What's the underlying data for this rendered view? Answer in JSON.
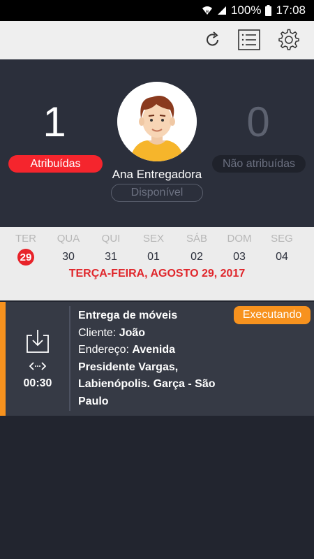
{
  "statusbar": {
    "battery": "100%",
    "time": "17:08"
  },
  "toolbar": {
    "refresh_icon": "refresh-icon",
    "list_icon": "list-icon",
    "settings_icon": "gear-icon"
  },
  "summary": {
    "assigned_count": "1",
    "assigned_label": "Atribuídas",
    "unassigned_count": "0",
    "unassigned_label": "Não atribuídas",
    "user_name": "Ana Entregadora",
    "user_status": "Disponível"
  },
  "calendar": {
    "days": [
      {
        "dow": "TER",
        "num": "29",
        "selected": true
      },
      {
        "dow": "QUA",
        "num": "30"
      },
      {
        "dow": "QUI",
        "num": "31"
      },
      {
        "dow": "SEX",
        "num": "01"
      },
      {
        "dow": "SÁB",
        "num": "02"
      },
      {
        "dow": "DOM",
        "num": "03"
      },
      {
        "dow": "SEG",
        "num": "04"
      }
    ],
    "selected_date": "TERÇA-FEIRA, AGOSTO 29, 2017"
  },
  "tasks": [
    {
      "title": "Entrega de móveis",
      "client_label": "Cliente:",
      "client_name": "João",
      "address_label": "Endereço:",
      "address_line1": "Avenida",
      "address_line2": "Presidente Vargas,",
      "address_line3": "Labienópolis. Garça - São",
      "address_line4": "Paulo",
      "time": "00:30",
      "status": "Executando"
    }
  ],
  "colors": {
    "accent_red": "#e8232a",
    "accent_orange": "#f7921e",
    "hero_bg": "#2b2f3b"
  }
}
